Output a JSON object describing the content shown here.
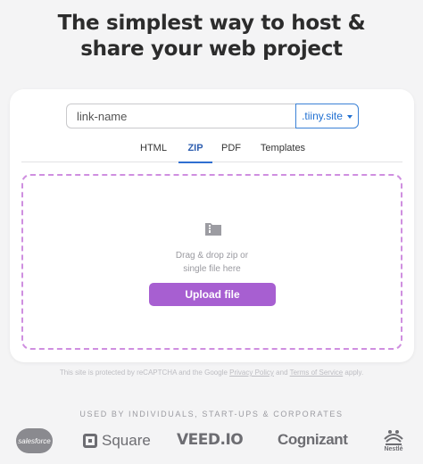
{
  "headline": {
    "line1": "The simplest way to host &",
    "line2": "share your web project"
  },
  "link": {
    "placeholder": "link-name",
    "domain_label": ".tiiny.site"
  },
  "tabs": [
    {
      "label": "HTML"
    },
    {
      "label": "ZIP",
      "active": true
    },
    {
      "label": "PDF"
    },
    {
      "label": "Templates"
    }
  ],
  "dropzone": {
    "line1": "Drag & drop zip or",
    "line2": "single file here",
    "upload_label": "Upload file",
    "border_color": "#cf8fe0"
  },
  "recaptcha": {
    "prefix": "This site is protected by reCAPTCHA and the Google",
    "privacy": "Privacy Policy",
    "and": "and",
    "terms": "Terms of Service",
    "suffix": "apply."
  },
  "used_by": "USED BY INDIVIDUALS, START-UPS & CORPORATES",
  "logos": {
    "salesforce": "salesforce",
    "square": "Square",
    "veed": "VEED.IO",
    "cognizant": "Cognizant",
    "nestle": "Nestlé"
  },
  "colors": {
    "accent": "#a75fd1",
    "link_blue": "#1f6fd1",
    "background": "#f4f4f5"
  }
}
